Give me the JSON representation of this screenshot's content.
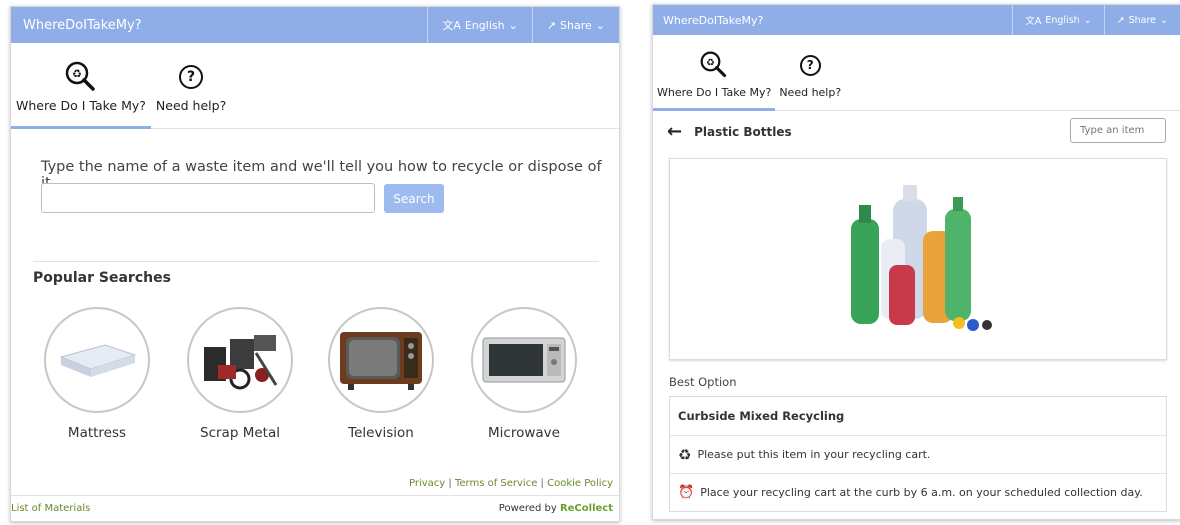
{
  "left": {
    "brand": "WhereDoITakeMy?",
    "language_label": "English",
    "share_label": "Share",
    "tabs": [
      {
        "label": "Where Do I Take My?"
      },
      {
        "label": "Need help?"
      }
    ],
    "lead": "Type the name of a waste item and we'll tell you how to recycle or dispose of it.",
    "search": {
      "value": "",
      "button_label": "Search"
    },
    "popular_title": "Popular Searches",
    "popular": [
      {
        "label": "Mattress",
        "icon": "mattress-image"
      },
      {
        "label": "Scrap Metal",
        "icon": "scrap-metal-image"
      },
      {
        "label": "Television",
        "icon": "television-image"
      },
      {
        "label": "Microwave",
        "icon": "microwave-image"
      }
    ],
    "legal": {
      "privacy": "Privacy",
      "sep": "|",
      "terms": "Terms of Service",
      "cookie": "Cookie Policy"
    },
    "footer": {
      "list_of_materials": "List of Materials",
      "powered_by": "Powered by",
      "brand": "ReCollect"
    }
  },
  "right": {
    "brand": "WhereDoITakeMy?",
    "language_label": "English",
    "share_label": "Share",
    "tabs": [
      {
        "label": "Where Do I Take My?"
      },
      {
        "label": "Need help?"
      }
    ],
    "item_title": "Plastic Bottles",
    "type_placeholder": "Type an item",
    "best_option_label": "Best Option",
    "option": {
      "title": "Curbside Mixed Recycling",
      "lines": [
        {
          "icon": "recycle-icon",
          "text": "Please put this item in your recycling cart."
        },
        {
          "icon": "alarm-clock-icon",
          "text": "Place your recycling cart at the curb by 6 a.m. on your scheduled collection day."
        }
      ]
    }
  },
  "colors": {
    "accent": "#8faee8",
    "button": "#9ebbf0",
    "link_green": "#6a8a2a"
  }
}
